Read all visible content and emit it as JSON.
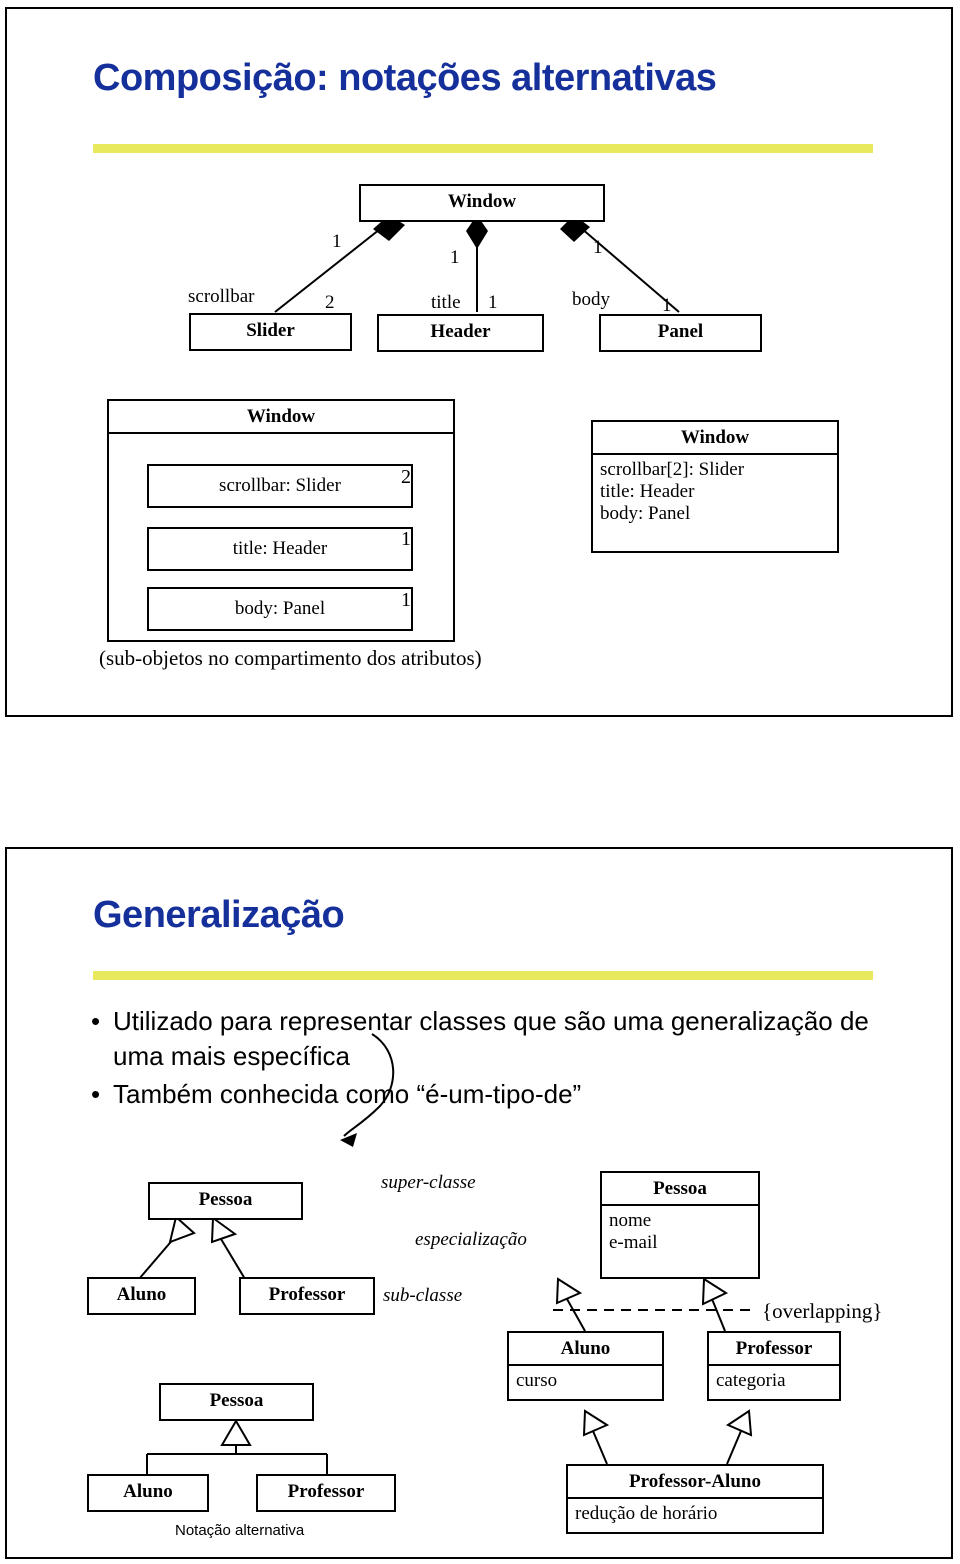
{
  "slide1": {
    "title": "Composição: notações alternativas",
    "accent_color": "#16309B",
    "rule_color": "#E9E95E",
    "diagram_top": {
      "parent": {
        "name": "Window"
      },
      "children": [
        {
          "name": "Slider",
          "role": "scrollbar",
          "parent_mult": "1",
          "child_mult": "2"
        },
        {
          "name": "Header",
          "role": "title",
          "parent_mult": "1",
          "child_mult": "1"
        },
        {
          "name": "Panel",
          "role": "body",
          "parent_mult": "1",
          "child_mult": "1"
        }
      ]
    },
    "diagram_nested": {
      "class_name": "Window",
      "parts": [
        {
          "label": "scrollbar: Slider",
          "mult": "2"
        },
        {
          "label": "title: Header",
          "mult": "1"
        },
        {
          "label": "body: Panel",
          "mult": "1"
        }
      ],
      "caption": "(sub-objetos no compartimento dos atributos)"
    },
    "diagram_textual": {
      "class_name": "Window",
      "attributes": [
        "scrollbar[2]: Slider",
        "title: Header",
        "body: Panel"
      ]
    }
  },
  "slide2": {
    "title": "Generalização",
    "accent_color": "#16309B",
    "rule_color": "#E9E95E",
    "bullets": [
      "Utilizado para representar classes que são uma generalização de uma mais específica",
      "Também conhecida como “é-um-tipo-de”"
    ],
    "diagram_basic": {
      "super": "Pessoa",
      "subs": [
        "Aluno",
        "Professor"
      ]
    },
    "annotations": {
      "super": "super-classe",
      "relation": "especialização",
      "sub": "sub-classe"
    },
    "diagram_attrs": {
      "super": {
        "name": "Pessoa",
        "attributes": [
          "nome",
          "e-mail"
        ]
      },
      "subs": [
        {
          "name": "Aluno",
          "attributes": [
            "curso"
          ]
        },
        {
          "name": "Professor",
          "attributes": [
            "categoria"
          ]
        }
      ],
      "constraint": "{overlapping}",
      "multiple": {
        "name": "Professor-Aluno",
        "attributes": [
          "redução de horário"
        ]
      }
    },
    "diagram_alternative": {
      "super": "Pessoa",
      "subs": [
        "Aluno",
        "Professor"
      ],
      "caption": "Notação alternativa"
    }
  }
}
